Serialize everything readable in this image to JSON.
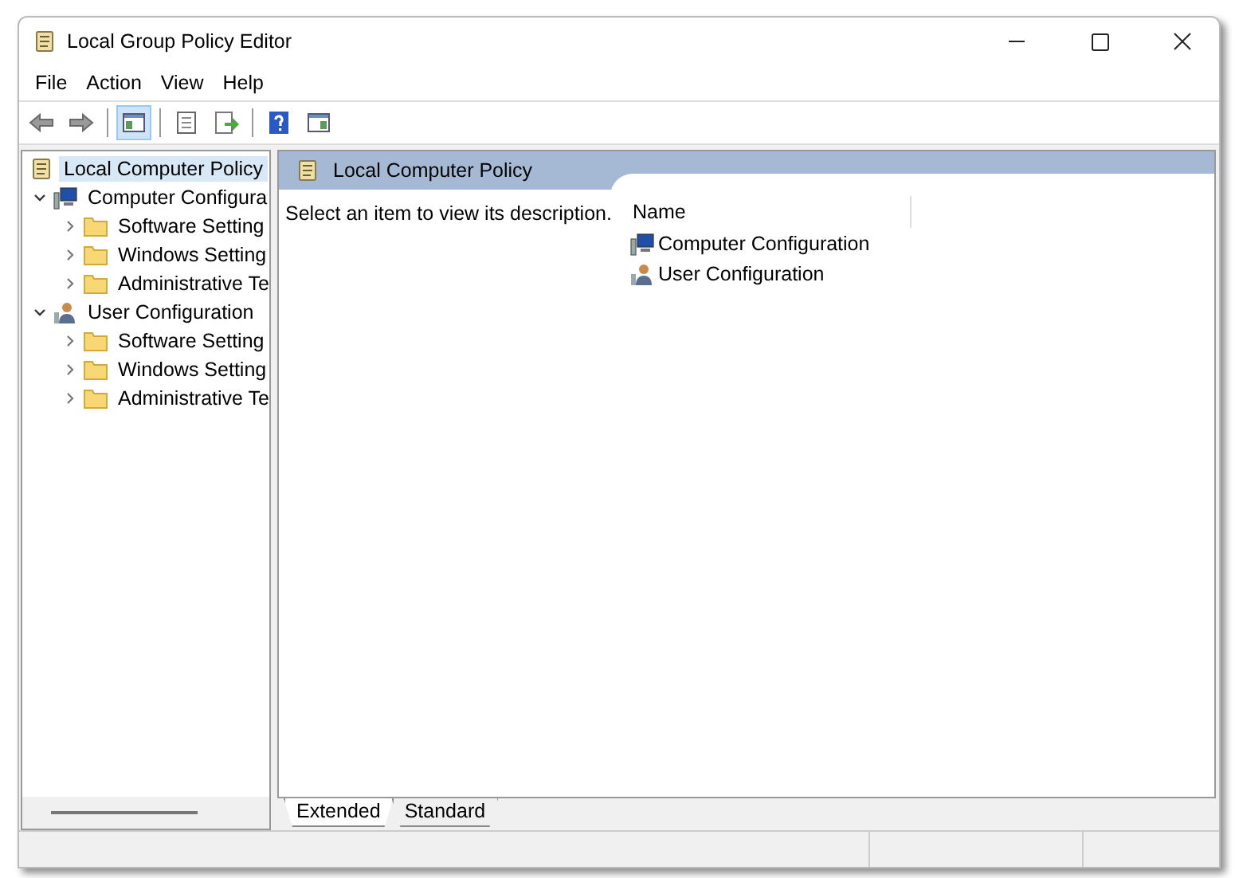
{
  "window": {
    "title": "Local Group Policy Editor"
  },
  "menu": [
    "File",
    "Action",
    "View",
    "Help"
  ],
  "toolbar": [
    {
      "kind": "back",
      "on": false
    },
    {
      "kind": "forward",
      "on": false
    },
    {
      "kind": "separator"
    },
    {
      "kind": "tree",
      "on": true
    },
    {
      "kind": "separator"
    },
    {
      "kind": "properties",
      "on": false
    },
    {
      "kind": "export",
      "on": false
    },
    {
      "kind": "separator"
    },
    {
      "kind": "help",
      "on": false
    },
    {
      "kind": "pane",
      "on": false
    }
  ],
  "tree": [
    {
      "label": "Local Computer Policy",
      "kind": "policy",
      "selected": true,
      "children": [
        {
          "label": "Computer Configura",
          "kind": "computer",
          "selected": false,
          "expanded": true,
          "children": [
            {
              "label": "Software Setting",
              "kind": "folder",
              "selected": false,
              "expanded": false
            },
            {
              "label": "Windows Setting",
              "kind": "folder",
              "selected": false,
              "expanded": false
            },
            {
              "label": "Administrative Te",
              "kind": "folder",
              "selected": false,
              "expanded": false
            }
          ]
        },
        {
          "label": "User Configuration",
          "kind": "user",
          "selected": false,
          "expanded": true,
          "children": [
            {
              "label": "Software Setting",
              "kind": "folder",
              "selected": false,
              "expanded": false
            },
            {
              "label": "Windows Setting",
              "kind": "folder",
              "selected": false,
              "expanded": false
            },
            {
              "label": "Administrative Te",
              "kind": "folder",
              "selected": false,
              "expanded": false
            }
          ]
        }
      ]
    }
  ],
  "details": {
    "header": "Local Computer Policy",
    "description": "Select an item to view its description.",
    "column": "Name",
    "items": [
      {
        "label": "Computer Configuration",
        "kind": "computer"
      },
      {
        "label": "User Configuration",
        "kind": "user"
      }
    ]
  },
  "tabs": [
    {
      "label": "Extended",
      "selected": true
    },
    {
      "label": "Standard",
      "selected": false
    }
  ]
}
